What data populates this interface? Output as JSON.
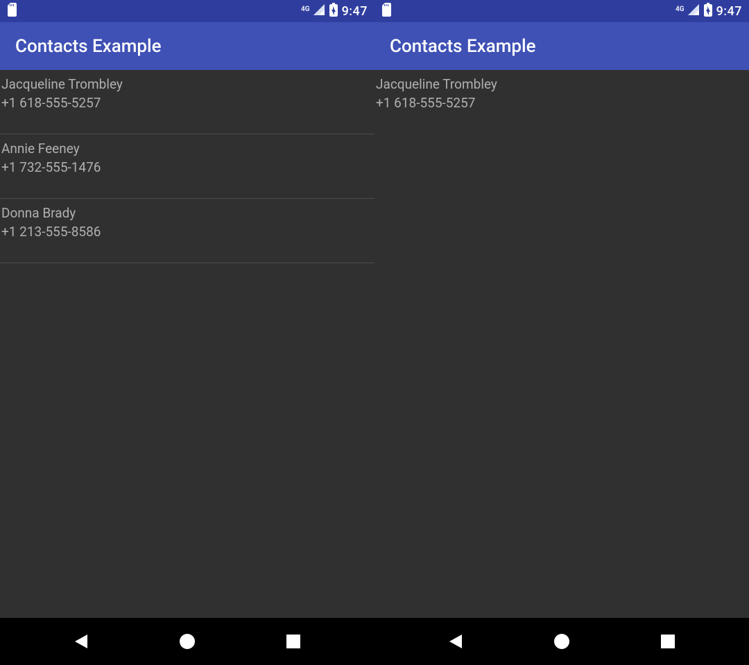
{
  "status": {
    "network_label": "4G",
    "time": "9:47"
  },
  "screens": [
    {
      "app_title": "Contacts Example",
      "contacts": [
        {
          "name": "Jacqueline Trombley",
          "phone": "+1 618-555-5257"
        },
        {
          "name": "Annie Feeney",
          "phone": "+1 732-555-1476"
        },
        {
          "name": "Donna Brady",
          "phone": "+1 213-555-8586"
        }
      ]
    },
    {
      "app_title": "Contacts Example",
      "contacts": [
        {
          "name": "Jacqueline Trombley",
          "phone": "+1 618-555-5257"
        }
      ]
    }
  ]
}
